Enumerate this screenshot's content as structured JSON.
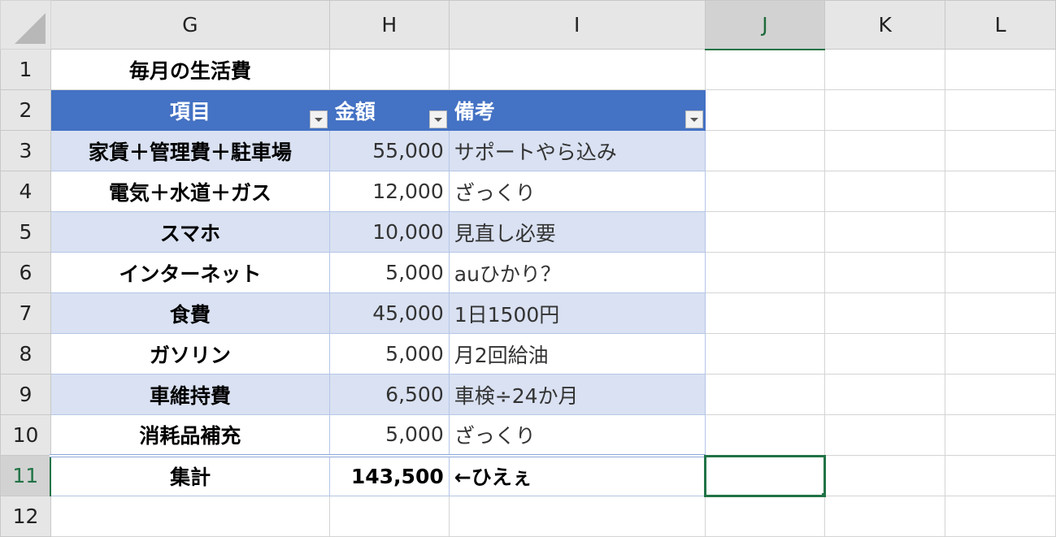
{
  "columns": [
    "G",
    "H",
    "I",
    "J",
    "K",
    "L"
  ],
  "selected_column": "J",
  "selected_row": 11,
  "title": "毎月の生活費",
  "table_headers": [
    "項目",
    "金額",
    "備考"
  ],
  "rows": [
    {
      "item": "家賃＋管理費＋駐車場",
      "amount": "55,000",
      "note": "サポートやら込み"
    },
    {
      "item": "電気＋水道＋ガス",
      "amount": "12,000",
      "note": "ざっくり"
    },
    {
      "item": "スマホ",
      "amount": "10,000",
      "note": "見直し必要"
    },
    {
      "item": "インターネット",
      "amount": "5,000",
      "note": "auひかり？"
    },
    {
      "item": "食費",
      "amount": "45,000",
      "note": "1日1500円"
    },
    {
      "item": "ガソリン",
      "amount": "5,000",
      "note": "月2回給油"
    },
    {
      "item": "車維持費",
      "amount": "6,500",
      "note": "車検÷24か月"
    },
    {
      "item": "消耗品補充",
      "amount": "5,000",
      "note": "ざっくり"
    }
  ],
  "total": {
    "item": "集計",
    "amount": "143,500",
    "note": "←ひえぇ"
  },
  "row_numbers": [
    "1",
    "2",
    "3",
    "4",
    "5",
    "6",
    "7",
    "8",
    "9",
    "10",
    "11",
    "12"
  ]
}
